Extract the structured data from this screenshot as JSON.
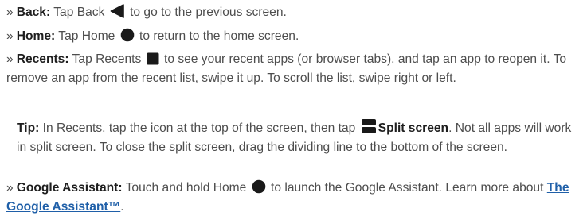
{
  "bullet_marker": "»",
  "icons": {
    "back": "back-triangle-icon",
    "home": "home-circle-icon",
    "recents": "recents-square-icon",
    "split": "split-screen-icon",
    "assistant": "assistant-circle-icon"
  },
  "colors": {
    "text": "#4d4d4d",
    "bold_text": "#1e1e1e",
    "link": "#1f5fa8",
    "icon": "#1a1a1a"
  },
  "items": {
    "back": {
      "term": "Back:",
      "before": "Tap Back",
      "after": "to go to the previous screen."
    },
    "home": {
      "term": "Home:",
      "before": "Tap Home",
      "after": "to return to the home screen."
    },
    "recents": {
      "term": "Recents:",
      "before": "Tap Recents",
      "after": "to see your recent apps (or browser tabs), and tap an app to reopen it. To remove an app from the recent list, swipe it up. To scroll the list, swipe right or left."
    },
    "tip": {
      "term": "Tip:",
      "before": "In Recents, tap the icon at the top of the screen, then tap",
      "bold": "Split screen",
      "after": ". Not all apps will work in split screen. To close the split screen, drag the dividing line to the bottom of the screen."
    },
    "assistant": {
      "term": "Google Assistant:",
      "before": "Touch and hold Home",
      "after": "to launch the Google Assistant. Learn more about",
      "link": "The Google Assistant™",
      "end": "."
    }
  }
}
